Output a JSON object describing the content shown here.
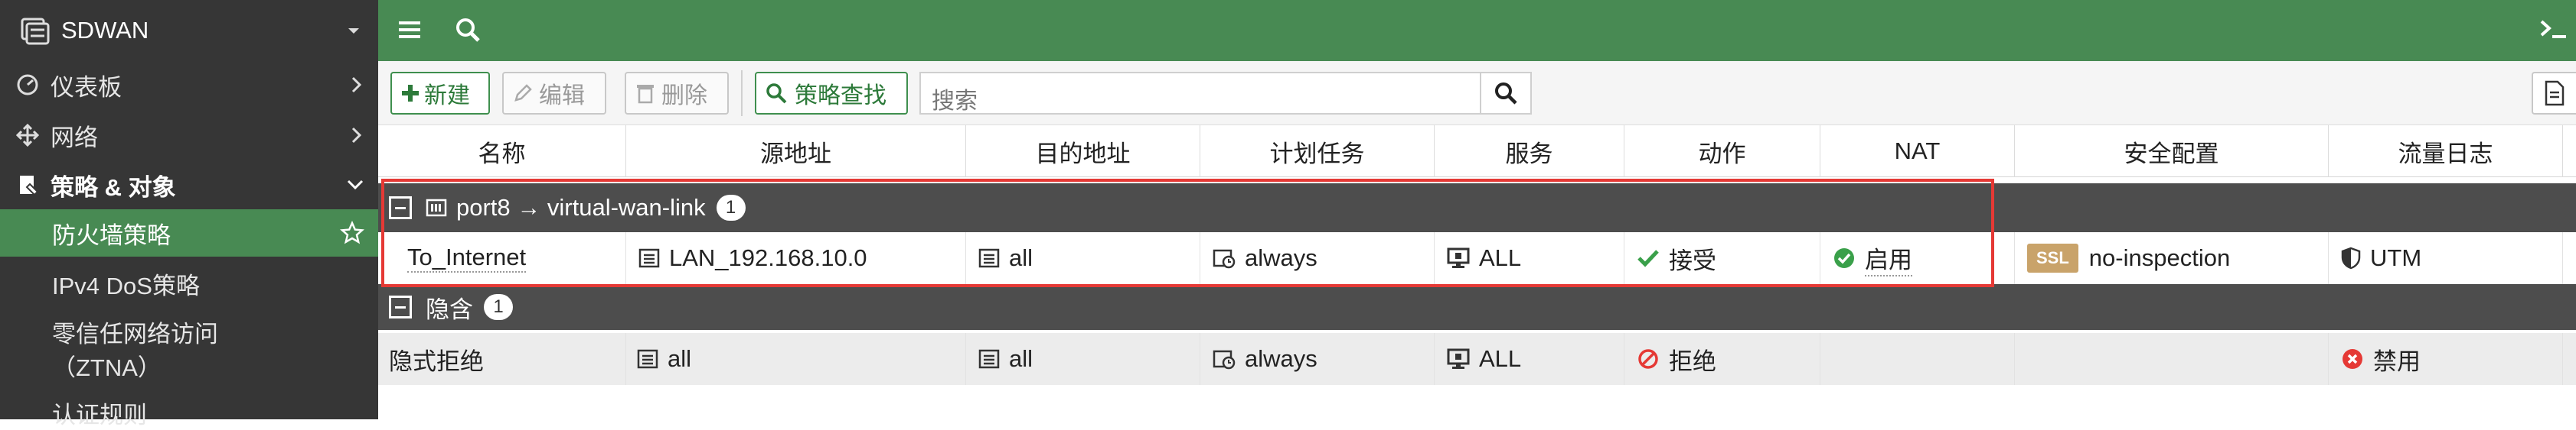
{
  "sidebar": {
    "app_name": "SDWAN",
    "items": [
      {
        "label": "仪表板"
      },
      {
        "label": "网络"
      },
      {
        "label": "策略 & 对象"
      },
      {
        "label": "防火墙策略"
      },
      {
        "label": "IPv4 DoS策略"
      },
      {
        "label": "零信任网络访问"
      },
      {
        "label": "（ZTNA）"
      },
      {
        "label": "认证规则"
      }
    ]
  },
  "toolbar": {
    "new_label": "新建",
    "edit_label": "编辑",
    "delete_label": "删除",
    "policy_lookup_label": "策略查找",
    "search_placeholder": "搜索"
  },
  "table": {
    "columns": [
      "名称",
      "源地址",
      "目的地址",
      "计划任务",
      "服务",
      "动作",
      "NAT",
      "安全配置",
      "流量日志"
    ],
    "groups": [
      {
        "title": "port8 → virtual-wan-link",
        "count": "1"
      },
      {
        "title": "隐含",
        "count": "1"
      }
    ],
    "rows": [
      {
        "name": "To_Internet",
        "source": "LAN_192.168.10.0",
        "destination": "all",
        "schedule": "always",
        "service": "ALL",
        "action": "接受",
        "nat": "启用",
        "security_badge": "SSL",
        "security": "no-inspection",
        "log": "UTM"
      },
      {
        "name": "隐式拒绝",
        "source": "all",
        "destination": "all",
        "schedule": "always",
        "service": "ALL",
        "action": "拒绝",
        "nat": "",
        "security": "",
        "log": "禁用"
      }
    ]
  },
  "colors": {
    "accent": "#488a53",
    "sidebar": "#363636",
    "group_row": "#4d4d4d",
    "highlight": "#e53935"
  }
}
